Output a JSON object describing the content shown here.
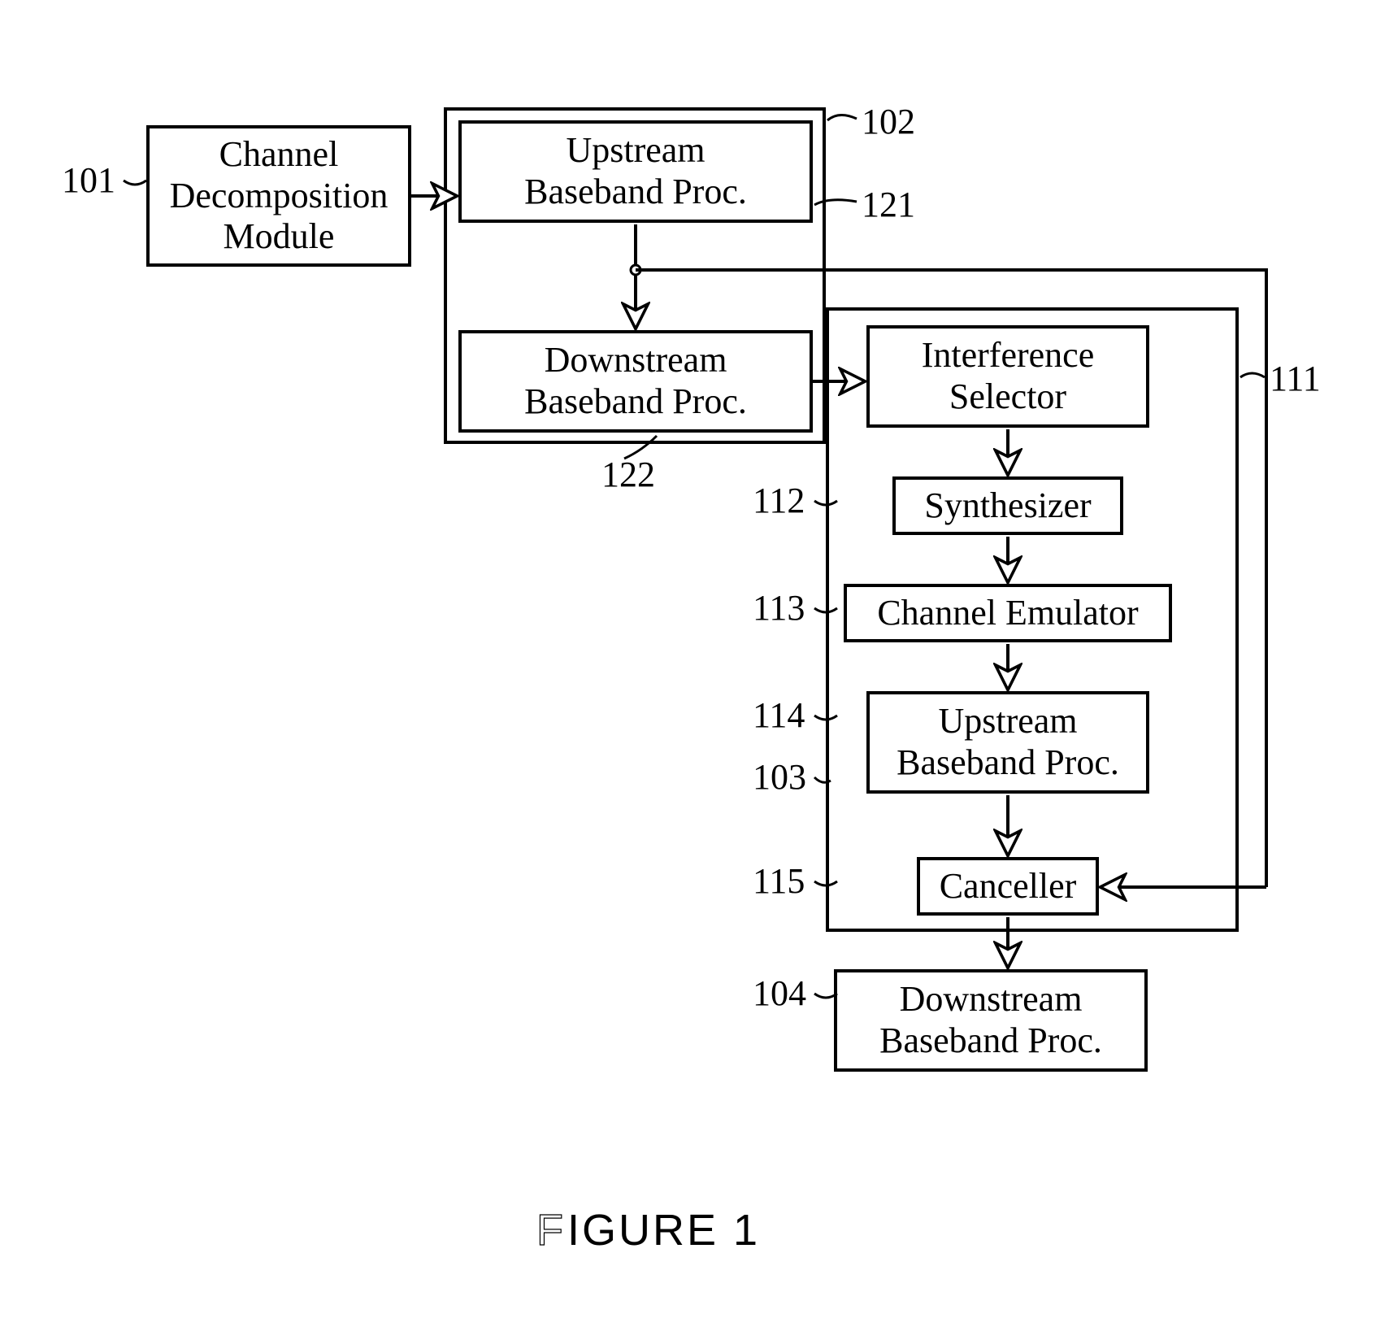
{
  "boxes": {
    "b101": "Channel\nDecomposition\nModule",
    "b121": "Upstream\nBaseband Proc.",
    "b122": "Downstream\nBaseband Proc.",
    "b111": "Interference\nSelector",
    "b112": "Synthesizer",
    "b113": "Channel Emulator",
    "b114": "Upstream\nBaseband Proc.",
    "b115": "Canceller",
    "b104": "Downstream\nBaseband Proc."
  },
  "labels": {
    "l101": "101",
    "l102": "102",
    "l121": "121",
    "l122": "122",
    "l111": "111",
    "l112": "112",
    "l113": "113",
    "l114": "114",
    "l103": "103",
    "l115": "115",
    "l104": "104"
  },
  "figure_caption": "FIGURE 1"
}
